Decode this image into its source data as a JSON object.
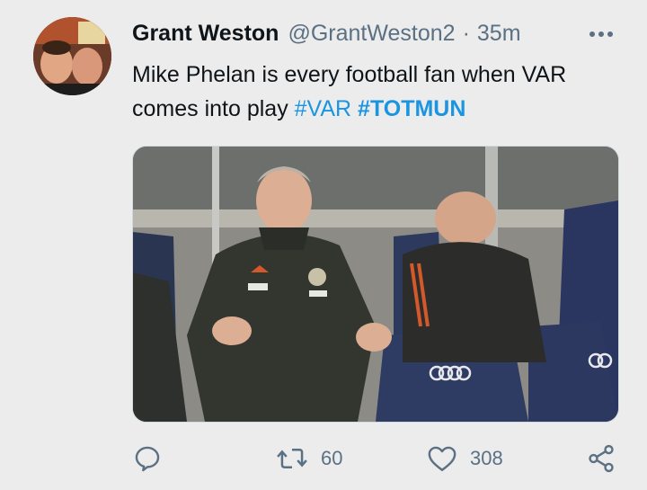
{
  "tweet": {
    "author_name": "Grant Weston",
    "author_handle": "@GrantWeston2",
    "separator": "·",
    "time": "35m",
    "text_before": "Mike Phelan is every football fan when VAR comes into play ",
    "hashtags": [
      "#VAR",
      "#TOTMUN"
    ],
    "media_alt_icon": "photo",
    "reply_icon": "reply-icon",
    "retweet_count": "60",
    "like_count": "308",
    "share_icon": "share-icon"
  },
  "colors": {
    "background": "#ececec",
    "text": "#0f1419",
    "secondary": "#5b7083",
    "hashtag": "#1b95e0"
  }
}
